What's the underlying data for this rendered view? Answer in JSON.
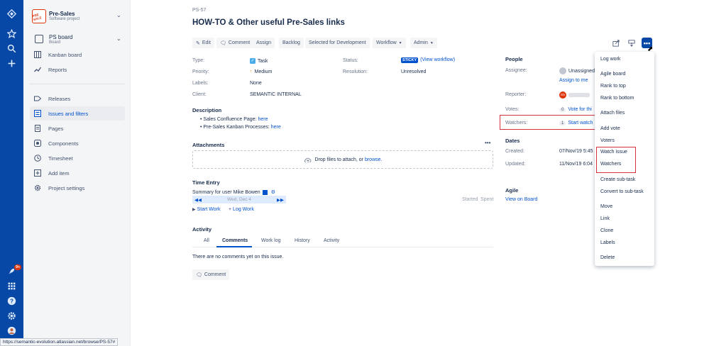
{
  "sidebar": {
    "project_name": "Pre-Sales",
    "project_type": "Software project",
    "project_logo_text": "PRE SALE",
    "board_name": "PS board",
    "board_type": "Board",
    "items": [
      {
        "label": "Kanban board"
      },
      {
        "label": "Reports"
      },
      {
        "label": "Releases"
      },
      {
        "label": "Issues and filters"
      },
      {
        "label": "Pages"
      },
      {
        "label": "Components"
      },
      {
        "label": "Timesheet"
      },
      {
        "label": "Add item"
      },
      {
        "label": "Project settings"
      }
    ]
  },
  "global_nav": {
    "notification_count": "9+"
  },
  "issue": {
    "key": "PS-57",
    "title": "HOW-TO & Other useful Pre-Sales links"
  },
  "toolbar": {
    "edit": "Edit",
    "comment": "Comment",
    "assign": "Assign",
    "backlog": "Backlog",
    "selected_dev": "Selected for Development",
    "workflow": "Workflow",
    "admin": "Admin"
  },
  "details": {
    "type_label": "Type:",
    "type_value": "Task",
    "priority_label": "Priority:",
    "priority_value": "Medium",
    "labels_label": "Labels:",
    "labels_value": "None",
    "client_label": "Client:",
    "client_value": "SEMANTIC INTERNAL",
    "status_label": "Status:",
    "status_value": "STICKY",
    "status_link": "(View workflow)",
    "resolution_label": "Resolution:",
    "resolution_value": "Unresolved"
  },
  "description": {
    "heading": "Description",
    "items": [
      {
        "text": "Sales Confluence Page: ",
        "link": "here"
      },
      {
        "text": "Pre-Sales Kanban Processes: ",
        "link": "here"
      }
    ]
  },
  "attachments": {
    "heading": "Attachments",
    "drop_text": "Drop files to attach, or ",
    "browse": "browse."
  },
  "time_entry": {
    "heading": "Time Entry",
    "summary": "Summary for user Mike Bowen",
    "date": "Wed, Dec 4",
    "started": "Started",
    "spent": "Spent",
    "start_work": "Start Work",
    "log_work": "Log Work"
  },
  "activity": {
    "heading": "Activity",
    "tabs": [
      {
        "label": "All"
      },
      {
        "label": "Comments"
      },
      {
        "label": "Work log"
      },
      {
        "label": "History"
      },
      {
        "label": "Activity"
      }
    ],
    "empty": "There are no comments yet on this issue.",
    "comment_button": "Comment"
  },
  "people": {
    "heading": "People",
    "assignee_label": "Assignee:",
    "assignee_value": "Unassigned",
    "assign_to_me": "Assign to me",
    "reporter_label": "Reporter:",
    "reporter_initials": "SS",
    "votes_label": "Votes:",
    "votes_count": "0",
    "votes_link": "Vote for thi",
    "watchers_label": "Watchers:",
    "watchers_count": "1",
    "watchers_link": "Start watch"
  },
  "dates": {
    "heading": "Dates",
    "created_label": "Created:",
    "created_value": "07/Nov/19 5:45",
    "updated_label": "Updated:",
    "updated_value": "11/Nov/19 6:04"
  },
  "agile": {
    "heading": "Agile",
    "link": "View on Board"
  },
  "menu": {
    "items": [
      {
        "label": "Log work"
      },
      {
        "label": "Agile board"
      },
      {
        "label": "Rank to top"
      },
      {
        "label": "Rank to bottom"
      },
      {
        "label": "Attach files"
      },
      {
        "label": "Add vote"
      },
      {
        "label": "Voters"
      },
      {
        "label": "Watch issue"
      },
      {
        "label": "Watchers"
      },
      {
        "label": "Create sub-task"
      },
      {
        "label": "Convert to sub-task"
      },
      {
        "label": "Move"
      },
      {
        "label": "Link"
      },
      {
        "label": "Clone"
      },
      {
        "label": "Labels"
      },
      {
        "label": "Delete"
      }
    ]
  },
  "status_url": "https://semantic-evolution.atlassian.net/browse/PS-57#",
  "colors": {
    "nav": "#0747a6",
    "link": "#0052cc",
    "highlight": "#d6303b",
    "sticky": "#0052cc"
  }
}
